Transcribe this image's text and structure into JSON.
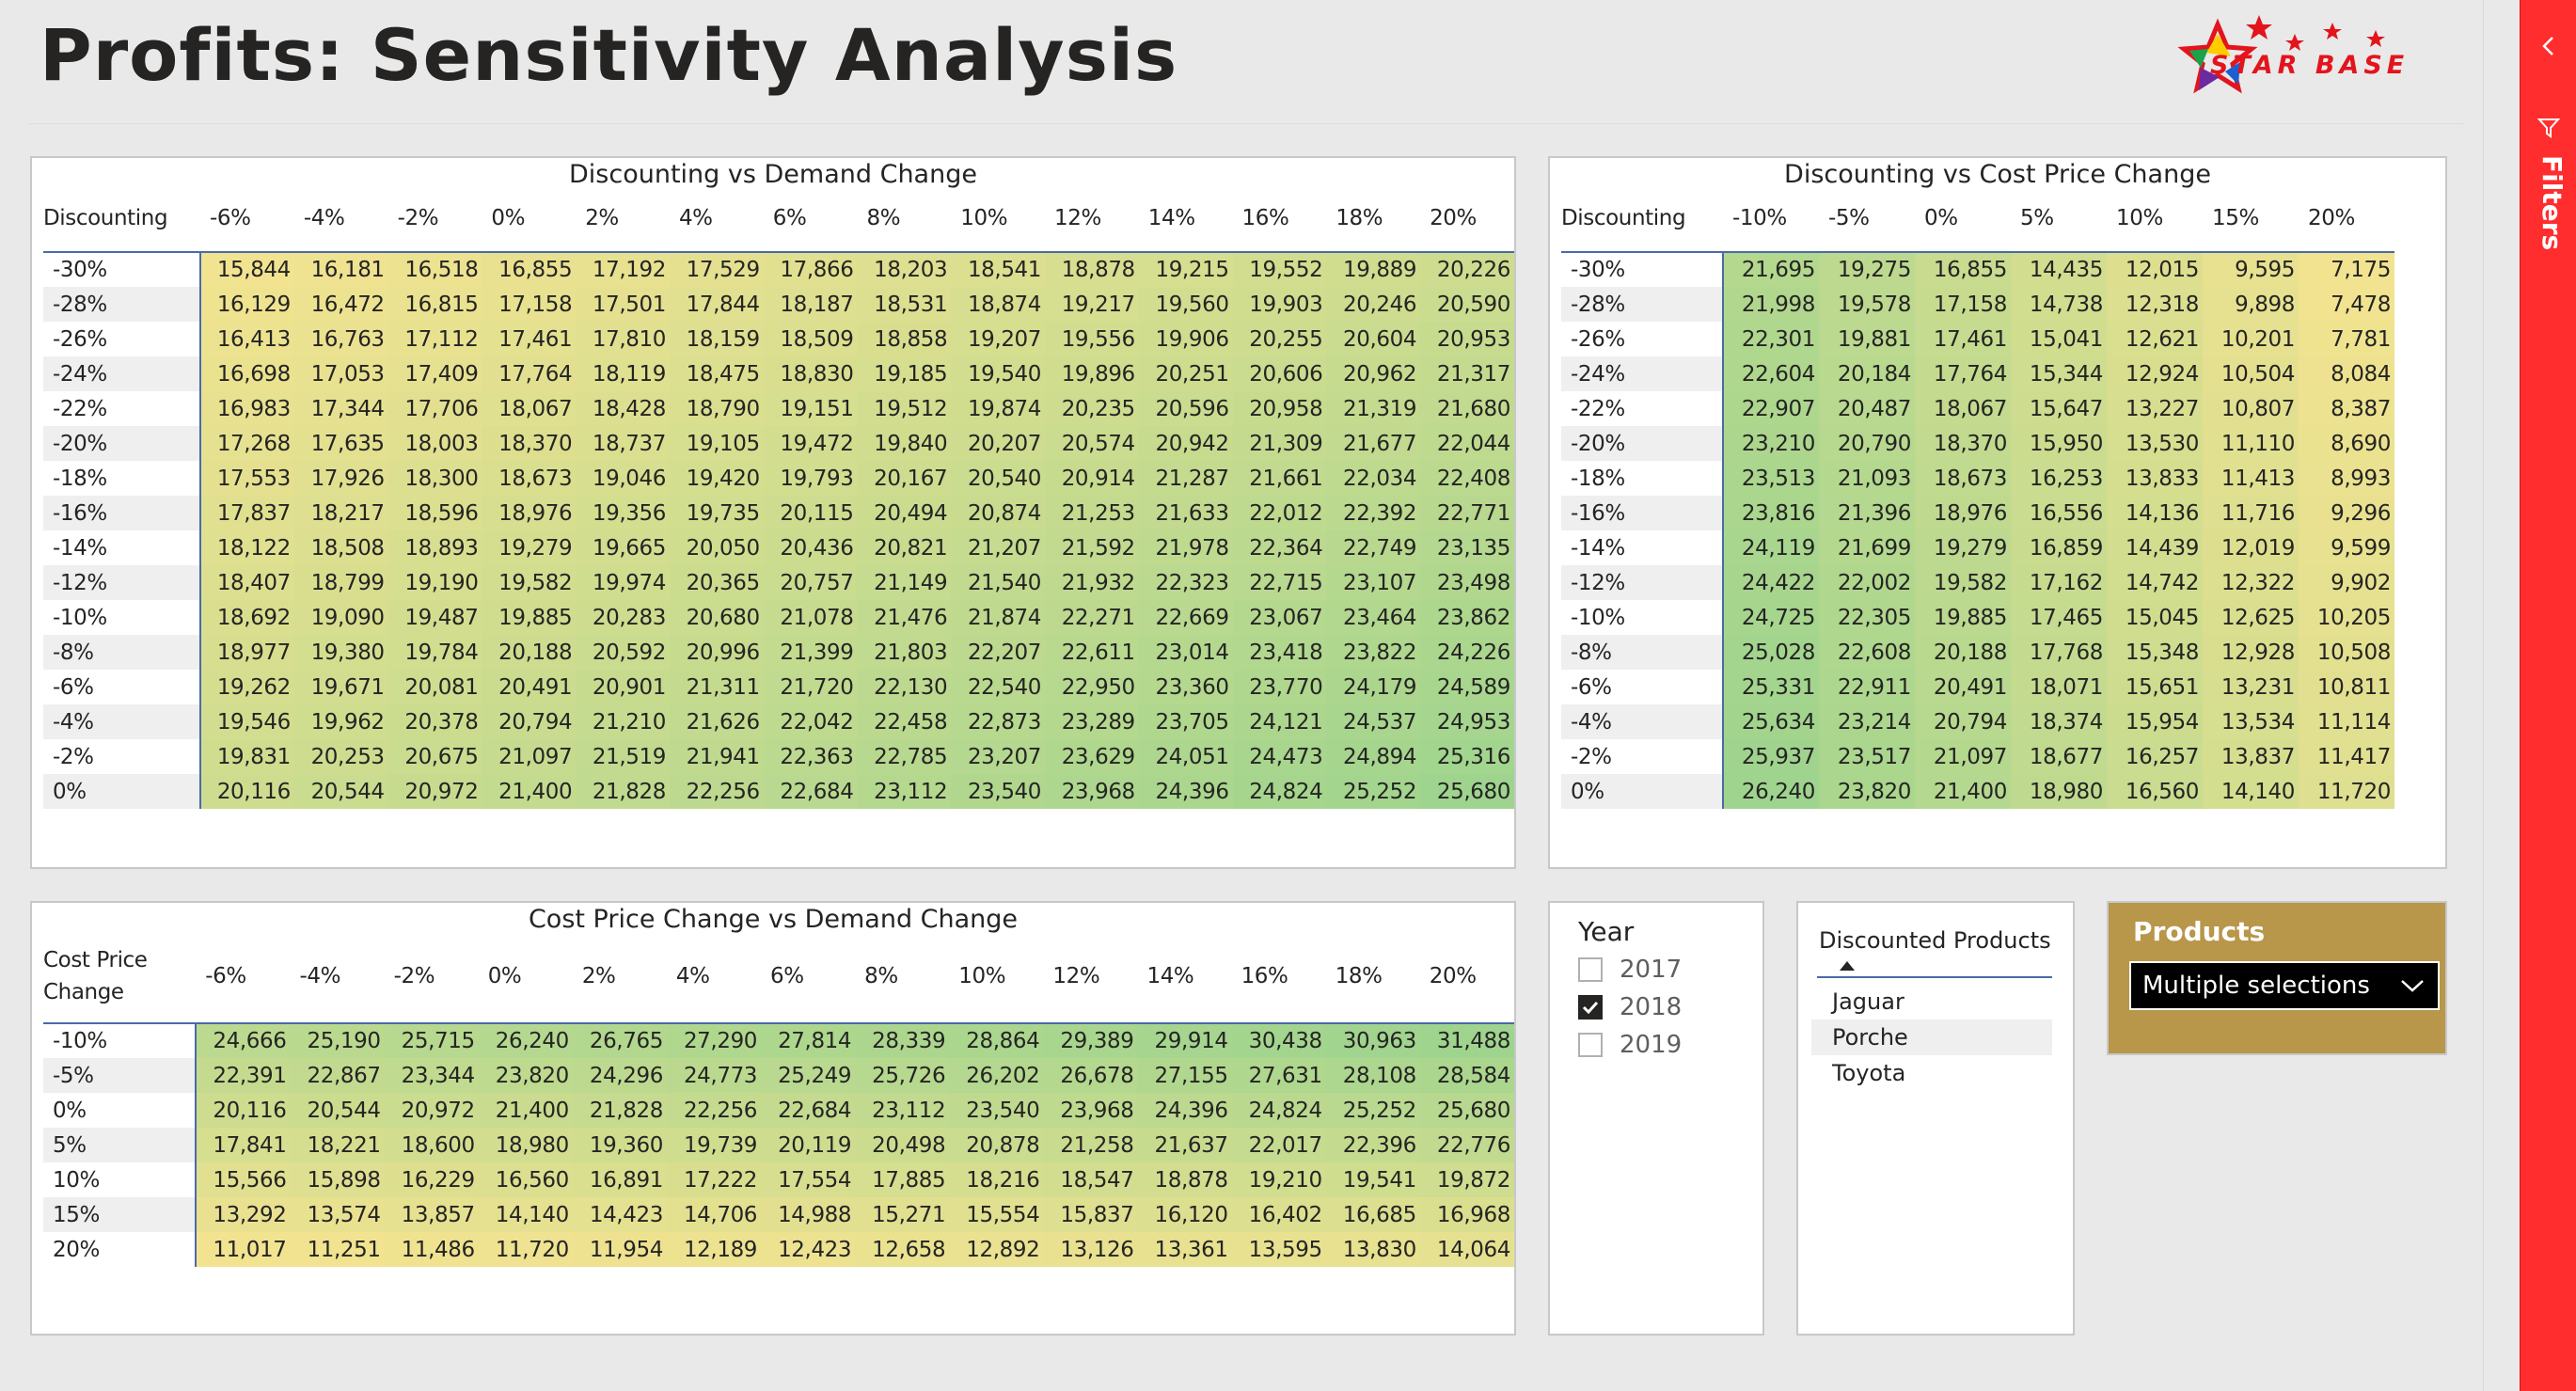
{
  "page": {
    "title": "Profits: Sensitivity Analysis"
  },
  "logo": {
    "text": "STAR BASE"
  },
  "filters_pane": {
    "label": "Filters"
  },
  "colors": {
    "low": "#f2e390",
    "high": "#9fd48e",
    "border_accent": "#4a6aa8",
    "products_bg": "#b8964a",
    "filters_bg": "#ff2d2d"
  },
  "matrix1": {
    "title": "Discounting vs Demand Change",
    "corner": "Discounting",
    "columns": [
      "-6%",
      "-4%",
      "-2%",
      "0%",
      "2%",
      "4%",
      "6%",
      "8%",
      "10%",
      "12%",
      "14%",
      "16%",
      "18%",
      "20%"
    ],
    "rows": [
      {
        "label": "-30%",
        "values": [
          15844,
          16181,
          16518,
          16855,
          17192,
          17529,
          17866,
          18203,
          18541,
          18878,
          19215,
          19552,
          19889,
          20226
        ]
      },
      {
        "label": "-28%",
        "values": [
          16129,
          16472,
          16815,
          17158,
          17501,
          17844,
          18187,
          18531,
          18874,
          19217,
          19560,
          19903,
          20246,
          20590
        ]
      },
      {
        "label": "-26%",
        "values": [
          16413,
          16763,
          17112,
          17461,
          17810,
          18159,
          18509,
          18858,
          19207,
          19556,
          19906,
          20255,
          20604,
          20953
        ]
      },
      {
        "label": "-24%",
        "values": [
          16698,
          17053,
          17409,
          17764,
          18119,
          18475,
          18830,
          19185,
          19540,
          19896,
          20251,
          20606,
          20962,
          21317
        ]
      },
      {
        "label": "-22%",
        "values": [
          16983,
          17344,
          17706,
          18067,
          18428,
          18790,
          19151,
          19512,
          19874,
          20235,
          20596,
          20958,
          21319,
          21680
        ]
      },
      {
        "label": "-20%",
        "values": [
          17268,
          17635,
          18003,
          18370,
          18737,
          19105,
          19472,
          19840,
          20207,
          20574,
          20942,
          21309,
          21677,
          22044
        ]
      },
      {
        "label": "-18%",
        "values": [
          17553,
          17926,
          18300,
          18673,
          19046,
          19420,
          19793,
          20167,
          20540,
          20914,
          21287,
          21661,
          22034,
          22408
        ]
      },
      {
        "label": "-16%",
        "values": [
          17837,
          18217,
          18596,
          18976,
          19356,
          19735,
          20115,
          20494,
          20874,
          21253,
          21633,
          22012,
          22392,
          22771
        ]
      },
      {
        "label": "-14%",
        "values": [
          18122,
          18508,
          18893,
          19279,
          19665,
          20050,
          20436,
          20821,
          21207,
          21592,
          21978,
          22364,
          22749,
          23135
        ]
      },
      {
        "label": "-12%",
        "values": [
          18407,
          18799,
          19190,
          19582,
          19974,
          20365,
          20757,
          21149,
          21540,
          21932,
          22323,
          22715,
          23107,
          23498
        ]
      },
      {
        "label": "-10%",
        "values": [
          18692,
          19090,
          19487,
          19885,
          20283,
          20680,
          21078,
          21476,
          21874,
          22271,
          22669,
          23067,
          23464,
          23862
        ]
      },
      {
        "label": "-8%",
        "values": [
          18977,
          19380,
          19784,
          20188,
          20592,
          20996,
          21399,
          21803,
          22207,
          22611,
          23014,
          23418,
          23822,
          24226
        ]
      },
      {
        "label": "-6%",
        "values": [
          19262,
          19671,
          20081,
          20491,
          20901,
          21311,
          21720,
          22130,
          22540,
          22950,
          23360,
          23770,
          24179,
          24589
        ]
      },
      {
        "label": "-4%",
        "values": [
          19546,
          19962,
          20378,
          20794,
          21210,
          21626,
          22042,
          22458,
          22873,
          23289,
          23705,
          24121,
          24537,
          24953
        ]
      },
      {
        "label": "-2%",
        "values": [
          19831,
          20253,
          20675,
          21097,
          21519,
          21941,
          22363,
          22785,
          23207,
          23629,
          24051,
          24473,
          24894,
          25316
        ]
      },
      {
        "label": "0%",
        "values": [
          20116,
          20544,
          20972,
          21400,
          21828,
          22256,
          22684,
          23112,
          23540,
          23968,
          24396,
          24824,
          25252,
          25680
        ]
      }
    ]
  },
  "matrix2": {
    "title": "Discounting vs Cost Price Change",
    "corner": "Discounting",
    "columns": [
      "-10%",
      "-5%",
      "0%",
      "5%",
      "10%",
      "15%",
      "20%"
    ],
    "rows": [
      {
        "label": "-30%",
        "values": [
          21695,
          19275,
          16855,
          14435,
          12015,
          9595,
          7175
        ]
      },
      {
        "label": "-28%",
        "values": [
          21998,
          19578,
          17158,
          14738,
          12318,
          9898,
          7478
        ]
      },
      {
        "label": "-26%",
        "values": [
          22301,
          19881,
          17461,
          15041,
          12621,
          10201,
          7781
        ]
      },
      {
        "label": "-24%",
        "values": [
          22604,
          20184,
          17764,
          15344,
          12924,
          10504,
          8084
        ]
      },
      {
        "label": "-22%",
        "values": [
          22907,
          20487,
          18067,
          15647,
          13227,
          10807,
          8387
        ]
      },
      {
        "label": "-20%",
        "values": [
          23210,
          20790,
          18370,
          15950,
          13530,
          11110,
          8690
        ]
      },
      {
        "label": "-18%",
        "values": [
          23513,
          21093,
          18673,
          16253,
          13833,
          11413,
          8993
        ]
      },
      {
        "label": "-16%",
        "values": [
          23816,
          21396,
          18976,
          16556,
          14136,
          11716,
          9296
        ]
      },
      {
        "label": "-14%",
        "values": [
          24119,
          21699,
          19279,
          16859,
          14439,
          12019,
          9599
        ]
      },
      {
        "label": "-12%",
        "values": [
          24422,
          22002,
          19582,
          17162,
          14742,
          12322,
          9902
        ]
      },
      {
        "label": "-10%",
        "values": [
          24725,
          22305,
          19885,
          17465,
          15045,
          12625,
          10205
        ]
      },
      {
        "label": "-8%",
        "values": [
          25028,
          22608,
          20188,
          17768,
          15348,
          12928,
          10508
        ]
      },
      {
        "label": "-6%",
        "values": [
          25331,
          22911,
          20491,
          18071,
          15651,
          13231,
          10811
        ]
      },
      {
        "label": "-4%",
        "values": [
          25634,
          23214,
          20794,
          18374,
          15954,
          13534,
          11114
        ]
      },
      {
        "label": "-2%",
        "values": [
          25937,
          23517,
          21097,
          18677,
          16257,
          13837,
          11417
        ]
      },
      {
        "label": "0%",
        "values": [
          26240,
          23820,
          21400,
          18980,
          16560,
          14140,
          11720
        ]
      }
    ]
  },
  "matrix3": {
    "title": "Cost Price Change vs Demand Change",
    "corner": "Cost Price Change",
    "columns": [
      "-6%",
      "-4%",
      "-2%",
      "0%",
      "2%",
      "4%",
      "6%",
      "8%",
      "10%",
      "12%",
      "14%",
      "16%",
      "18%",
      "20%"
    ],
    "rows": [
      {
        "label": "-10%",
        "values": [
          24666,
          25190,
          25715,
          26240,
          26765,
          27290,
          27814,
          28339,
          28864,
          29389,
          29914,
          30438,
          30963,
          31488
        ]
      },
      {
        "label": "-5%",
        "values": [
          22391,
          22867,
          23344,
          23820,
          24296,
          24773,
          25249,
          25726,
          26202,
          26678,
          27155,
          27631,
          28108,
          28584
        ]
      },
      {
        "label": "0%",
        "values": [
          20116,
          20544,
          20972,
          21400,
          21828,
          22256,
          22684,
          23112,
          23540,
          23968,
          24396,
          24824,
          25252,
          25680
        ]
      },
      {
        "label": "5%",
        "values": [
          17841,
          18221,
          18600,
          18980,
          19360,
          19739,
          20119,
          20498,
          20878,
          21258,
          21637,
          22017,
          22396,
          22776
        ]
      },
      {
        "label": "10%",
        "values": [
          15566,
          15898,
          16229,
          16560,
          16891,
          17222,
          17554,
          17885,
          18216,
          18547,
          18878,
          19210,
          19541,
          19872
        ]
      },
      {
        "label": "15%",
        "values": [
          13292,
          13574,
          13857,
          14140,
          14423,
          14706,
          14988,
          15271,
          15554,
          15837,
          16120,
          16402,
          16685,
          16968
        ]
      },
      {
        "label": "20%",
        "values": [
          11017,
          11251,
          11486,
          11720,
          11954,
          12189,
          12423,
          12658,
          12892,
          13126,
          13361,
          13595,
          13830,
          14064
        ]
      }
    ]
  },
  "year_slicer": {
    "title": "Year",
    "options": [
      {
        "label": "2017",
        "checked": false
      },
      {
        "label": "2018",
        "checked": true
      },
      {
        "label": "2019",
        "checked": false
      }
    ]
  },
  "discounted_products": {
    "header": "Discounted Products",
    "items": [
      "Jaguar",
      "Porche",
      "Toyota"
    ]
  },
  "products_slicer": {
    "title": "Products",
    "selected": "Multiple selections"
  }
}
